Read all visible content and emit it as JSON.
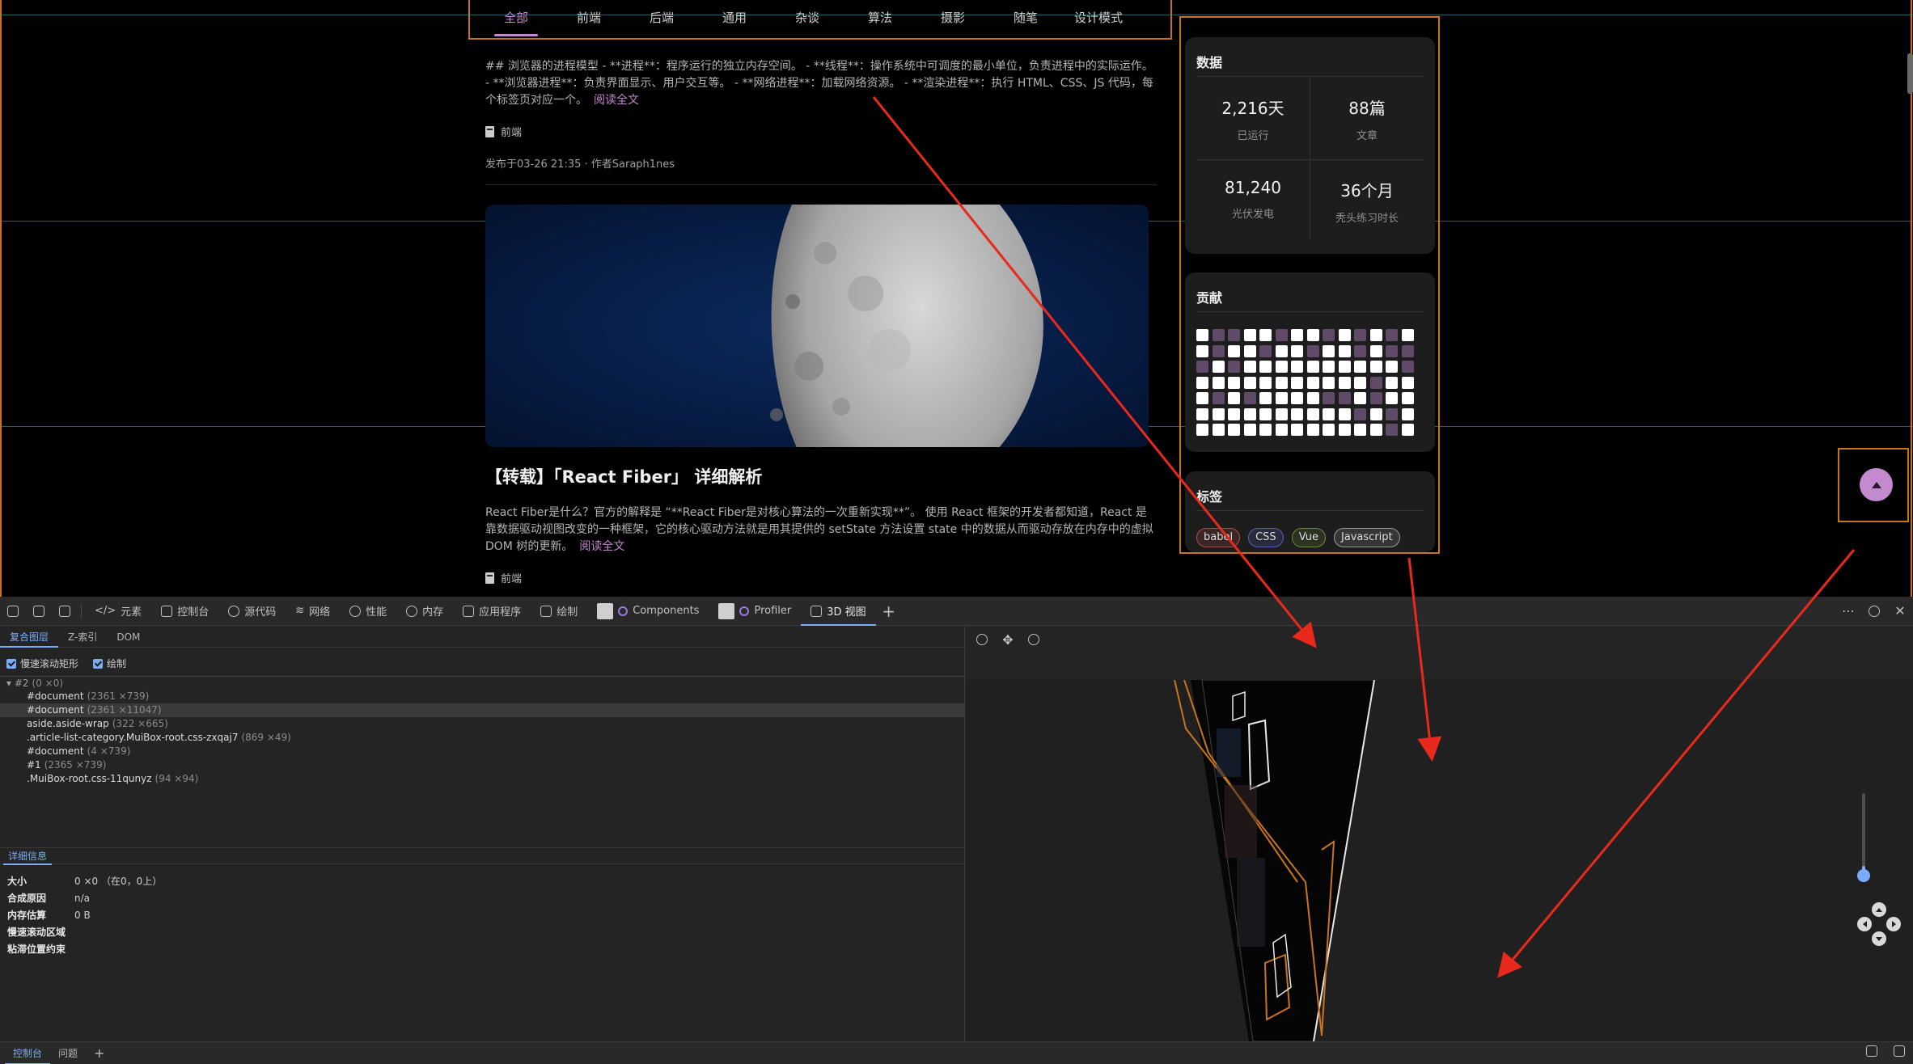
{
  "nav": {
    "tabs": [
      "全部",
      "前端",
      "后端",
      "通用",
      "杂谈",
      "算法",
      "摄影",
      "随笔",
      "设计模式"
    ],
    "active_index": 0
  },
  "article1": {
    "excerpt": "## 浏览器的进程模型 - **进程**：程序运行的独立内存空间。 - **线程**：操作系统中可调度的最小单位，负责进程中的实际运作。 - **浏览器进程**：负责界面显示、用户交互等。 - **网络进程**：加载网络资源。 - **渲染进程**：执行 HTML、CSS、JS 代码，每个标签页对应一个。",
    "read_more": "阅读全文",
    "category": "前端",
    "meta": "发布于03-26 21:35 · 作者Saraph1nes"
  },
  "article2": {
    "title": "【转载】「React Fiber」 详细解析",
    "excerpt": "React Fiber是什么？官方的解释是 “**React Fiber是对核心算法的一次重新实现**”。 使用 React 框架的开发者都知道，React 是靠数据驱动视图改变的一种框架，它的核心驱动方法就是用其提供的 setState 方法设置 state 中的数据从而驱动存放在内存中的虚拟 DOM 树的更新。",
    "read_more": "阅读全文",
    "category": "前端"
  },
  "stats_card": {
    "title": "数据",
    "items": [
      {
        "value": "2,216天",
        "label": "已运行"
      },
      {
        "value": "88篇",
        "label": "文章"
      },
      {
        "value": "81,240",
        "label": "光伏发电"
      },
      {
        "value": "36个月",
        "label": "秃头练习时长"
      }
    ]
  },
  "contrib_card": {
    "title": "贡献",
    "rows": [
      "wppwwpwwpwpwpw",
      "wpwwpwwpwwpwpp",
      "pwpwwwwwwwwwwp",
      "wwwwwwwwwwwpww",
      "wpwpwwwwppwpww",
      "wwwwwwwwwwpwpw",
      "wwwwwwwwwwwwpw"
    ]
  },
  "tags_card": {
    "title": "标签",
    "tags": [
      {
        "label": "babel",
        "color": "#b34a4a"
      },
      {
        "label": "CSS",
        "color": "#5a5fb8"
      },
      {
        "label": "Vue",
        "color": "#6b8a3a"
      },
      {
        "label": "Javascript",
        "color": "#9b9b9b"
      }
    ]
  },
  "devtools": {
    "tabs": [
      "元素",
      "控制台",
      "源代码",
      "网络",
      "性能",
      "内存",
      "应用程序",
      "绘制",
      "Components",
      "Profiler",
      "3D 视图"
    ],
    "active_tab": "3D 视图",
    "sub_tabs": [
      "复合图层",
      "Z-索引",
      "DOM"
    ],
    "checkboxes": [
      "慢速滚动矩形",
      "绘制"
    ],
    "tree": [
      {
        "name": "#2",
        "dim": "(0 ×0)",
        "root": true
      },
      {
        "name": "#document",
        "dim": "(2361 ×739)"
      },
      {
        "name": "#document",
        "dim": "(2361 ×11047)",
        "selected": true
      },
      {
        "name": "aside.aside-wrap",
        "dim": "(322 ×665)"
      },
      {
        "name": ".article-list-category.MuiBox-root.css-zxqaj7",
        "dim": "(869 ×49)"
      },
      {
        "name": "#document",
        "dim": "(4 ×739)"
      },
      {
        "name": "#1",
        "dim": "(2365 ×739)"
      },
      {
        "name": ".MuiBox-root.css-11qunyz",
        "dim": "(94 ×94)"
      }
    ],
    "details_tab": "详细信息",
    "details": [
      {
        "k": "大小",
        "v": "0 ×0 （在0，0上）"
      },
      {
        "k": "合成原因",
        "v": "n/a"
      },
      {
        "k": "内存估算",
        "v": "0 B"
      },
      {
        "k": "慢速滚动区域",
        "v": ""
      },
      {
        "k": "粘滞位置约束",
        "v": ""
      }
    ],
    "bottom_tabs": [
      "控制台",
      "问题"
    ]
  },
  "colors": {
    "accent": "#c48ad0",
    "highlight": "#c8741f",
    "devtools_blue": "#7cacf8",
    "arrow": "#e8291c"
  }
}
